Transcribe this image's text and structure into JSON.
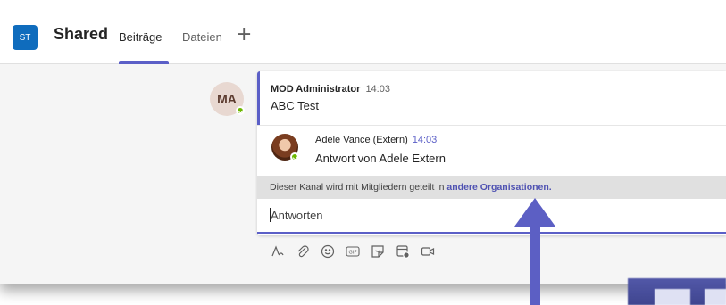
{
  "header": {
    "team_initials": "ST",
    "channel_name": "Shared",
    "tabs": [
      {
        "label": "Beiträge",
        "active": true
      },
      {
        "label": "Dateien",
        "active": false
      }
    ],
    "add_tab_icon": "+"
  },
  "thread": {
    "author_avatar": "MA",
    "post": {
      "author": "MOD Administrator",
      "time": "14:03",
      "body": "ABC Test"
    },
    "reply": {
      "author": "Adele Vance (Extern)",
      "time": "14:03",
      "body": "Antwort von Adele Extern"
    },
    "banner": {
      "text": "Dieser Kanal wird mit Mitgliedern geteilt in ",
      "link": "andere Organisationen."
    },
    "reply_input": {
      "value": "Antworten"
    }
  },
  "toolbar": {
    "icons": [
      "format-icon",
      "attach-icon",
      "emoji-icon",
      "gif-icon",
      "sticker-icon",
      "schedule-meeting-icon",
      "video-icon"
    ]
  },
  "colors": {
    "accent": "#5b5fc7",
    "team_avatar": "#0f6cbd",
    "presence": "#6bb700",
    "arrow": "#5c5fc4"
  }
}
